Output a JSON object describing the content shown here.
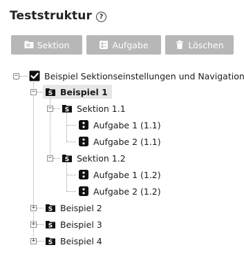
{
  "header": {
    "title": "Teststruktur",
    "help_icon": "help-circle-icon"
  },
  "toolbar": {
    "sektion_label": "Sektion",
    "aufgabe_label": "Aufgabe",
    "loeschen_label": "Löschen",
    "icons": {
      "sektion": "section-icon",
      "aufgabe": "task-icon",
      "loeschen": "trash-icon"
    }
  },
  "tree": {
    "root": {
      "label": "Beispiel Sektionseinstellungen und Navigation",
      "checked": true
    },
    "beispiel1": {
      "label": "Beispiel 1",
      "selected": true,
      "sektion11": {
        "label": "Sektion 1.1",
        "tasks": [
          "Aufgabe 1 (1.1)",
          "Aufgabe 2 (1.1)"
        ]
      },
      "sektion12": {
        "label": "Sektion 1.2",
        "tasks": [
          "Aufgabe 1 (1.2)",
          "Aufgabe 2 (1.2)"
        ]
      }
    },
    "beispiel2": {
      "label": "Beispiel 2"
    },
    "beispiel3": {
      "label": "Beispiel 3"
    },
    "beispiel4": {
      "label": "Beispiel 4"
    }
  },
  "colors": {
    "button_bg": "#b7b7b7",
    "button_text": "#ffffff",
    "selected_bg": "#e6e6e6",
    "tree_line": "#9a9a9a"
  }
}
